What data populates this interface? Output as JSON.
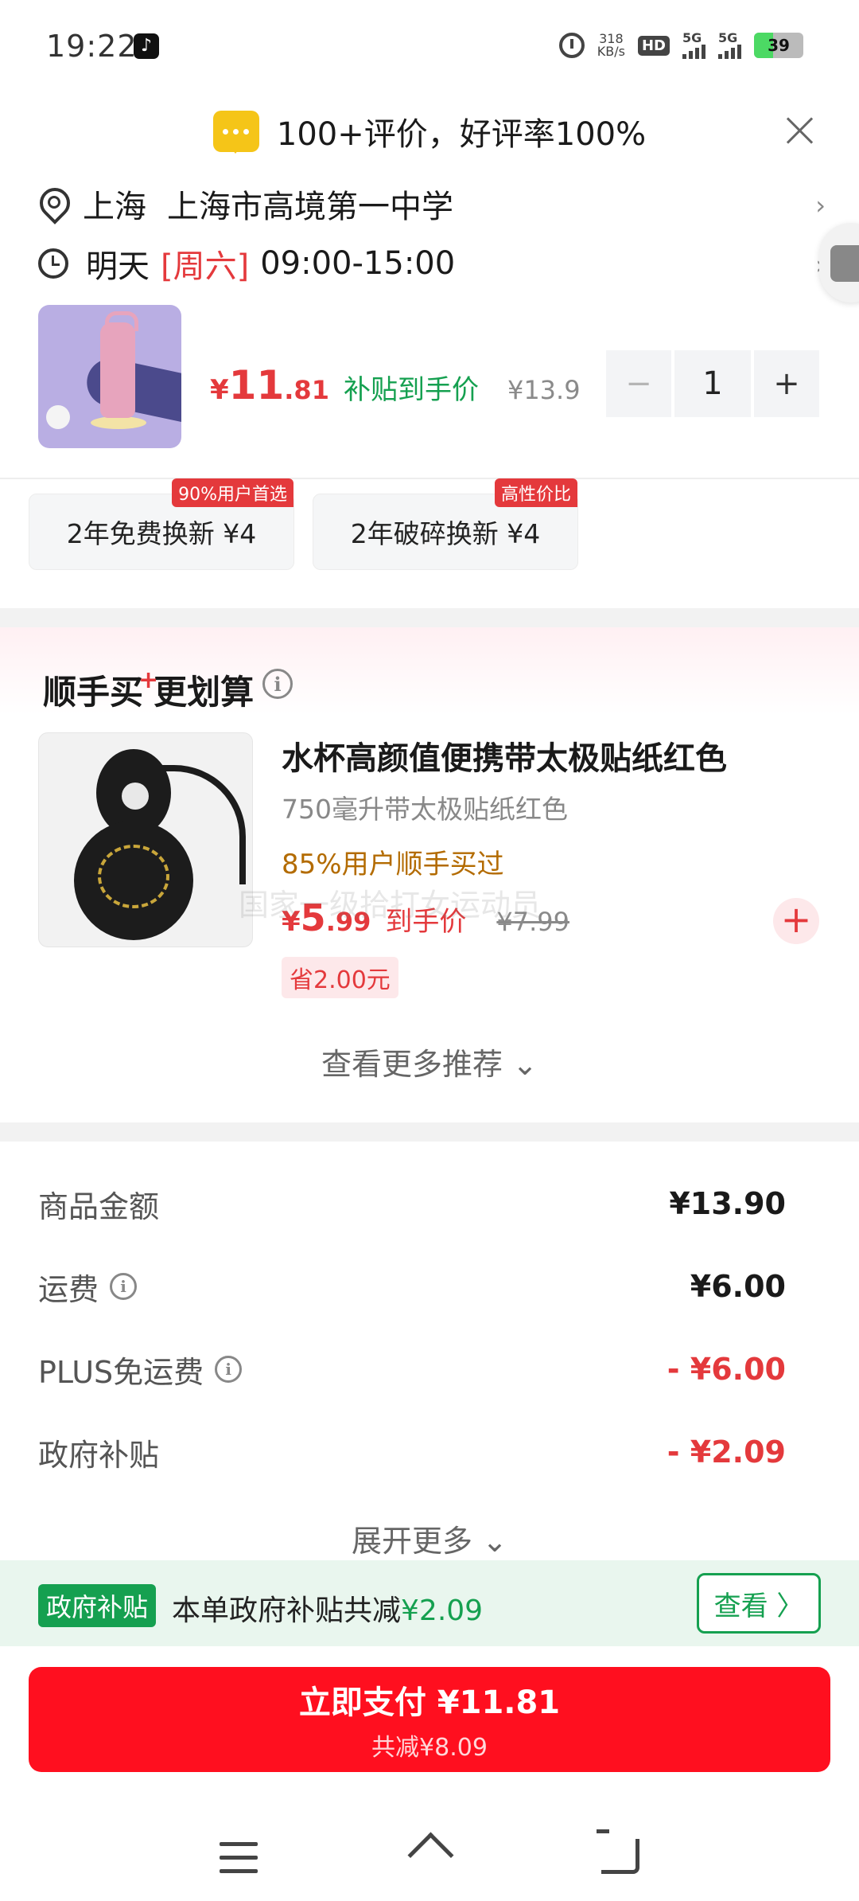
{
  "status_bar": {
    "time": "19:22",
    "tiktok_glyph": "♪",
    "net_speed_value": "318",
    "net_speed_unit": "KB/s",
    "hd_label": "HD",
    "signal_1": "5G",
    "signal_2": "5G",
    "battery": "39"
  },
  "review_banner": {
    "text": "100+评价，好评率100%"
  },
  "delivery": {
    "city": "上海",
    "address": "上海市高境第一中学",
    "day": "明天",
    "weekday": "[周六]",
    "time_window": "09:00-15:00"
  },
  "product": {
    "price_symbol": "¥",
    "price_int": "11",
    "price_dec": ".81",
    "subsidy_label": "补贴到手价",
    "original_price": "¥13.9",
    "quantity": "1",
    "minus": "−",
    "plus": "+"
  },
  "services": [
    {
      "label": "2年免费换新  ¥4",
      "tag": "90%用户首选"
    },
    {
      "label": "2年破碎换新  ¥4",
      "tag": "高性价比"
    }
  ],
  "bundle": {
    "title_part1": "顺手买",
    "title_plus": "+",
    "title_part2": "更划算",
    "info_glyph": "i",
    "item": {
      "name": "水杯高颜值便携带太极贴纸红色",
      "spec": "750毫升带太极贴纸红色",
      "bought": "85%用户顺手买过",
      "price_symbol": "¥",
      "price_int": "5",
      "price_dec": ".99",
      "to_hand": "到手价",
      "original_price": "¥7.99",
      "save": "省2.00元",
      "add": "+"
    },
    "watermark": "国家一级拾打女运动员",
    "see_more": "查看更多推荐 ⌄"
  },
  "costs": [
    {
      "label": "商品金额",
      "value": "¥13.90",
      "info": false,
      "red": false
    },
    {
      "label": "运费",
      "value": "¥6.00",
      "info": true,
      "red": false
    },
    {
      "label": "PLUS免运费",
      "value": "- ¥6.00",
      "info": true,
      "red": true
    },
    {
      "label": "政府补贴",
      "value": "- ¥2.09",
      "info": false,
      "red": true
    }
  ],
  "expand_more": "展开更多 ⌄",
  "gov_banner": {
    "tag": "政府补贴",
    "text": "本单政府补贴共减",
    "amount": "¥2.09",
    "button": "查看 〉"
  },
  "pay": {
    "main": "立即支付  ¥11.81",
    "sub": "共减¥8.09"
  },
  "colors": {
    "accent_red": "#e4393c",
    "pay_red": "#ff0f1f",
    "subsidy_green": "#15a050"
  }
}
